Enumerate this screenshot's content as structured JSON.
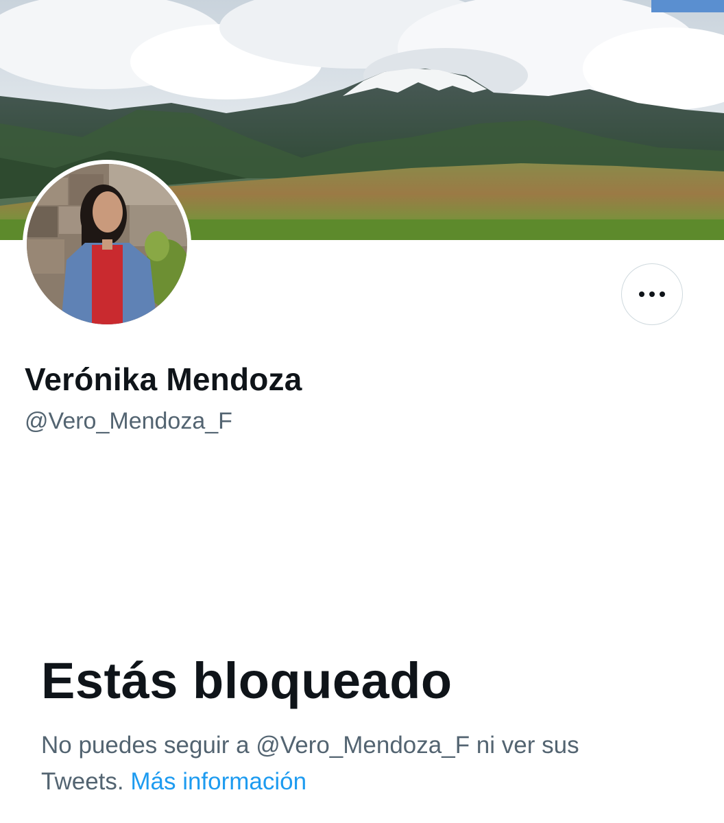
{
  "profile": {
    "display_name": "Verónika Mendoza",
    "handle": "@Vero_Mendoza_F",
    "banner_image": "mountain-landscape-banner",
    "avatar_image": "profile-photo"
  },
  "actions": {
    "more_icon": "more-horizontal-icon"
  },
  "blocked": {
    "title": "Estás bloqueado",
    "description_part1": "No puedes seguir a @Vero_Mendoza_F ni ver sus Tweets.",
    "link_label": "Más información"
  },
  "colors": {
    "primary_text": "#0f1419",
    "secondary_text": "#536471",
    "link": "#1d9bf0",
    "border": "#cfd9de"
  }
}
